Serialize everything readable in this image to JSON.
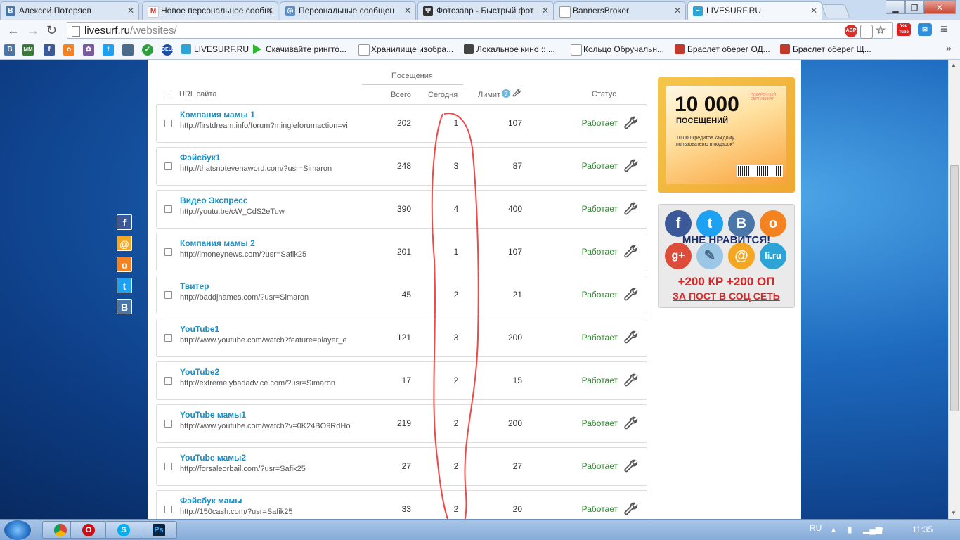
{
  "browser": {
    "tabs": [
      {
        "title": "Алексей Потеряев",
        "icon": "vk-icon",
        "color": "#4a76a8",
        "glyph": "В"
      },
      {
        "title": "Новое персональное сообщ",
        "icon": "gmail-icon",
        "color": "#d93025",
        "glyph": "M"
      },
      {
        "title": "Персональные сообщен",
        "icon": "globe-icon",
        "color": "#5b8fc7",
        "glyph": "◎"
      },
      {
        "title": "Фотозавр - Быстрый фот",
        "icon": "photozavr-icon",
        "color": "#333333",
        "glyph": "Ψ"
      },
      {
        "title": "BannersBroker",
        "icon": "page-icon",
        "color": "#ffffff",
        "glyph": ""
      },
      {
        "title": "LIVESURF.RU",
        "icon": "livesurf-icon",
        "color": "#2ea3d6",
        "glyph": "~"
      }
    ],
    "url_host": "livesurf.ru",
    "url_path": "/websites/",
    "bookmarks": [
      {
        "label": "LIVESURF.RU",
        "color": "#2ea3d6"
      },
      {
        "label": "Скачивайте рингто...",
        "color": "#2eb82e"
      },
      {
        "label": "Хранилище изобра...",
        "color": "#ffffff"
      },
      {
        "label": "Локальное кино :: ...",
        "color": "#444444"
      },
      {
        "label": "Кольцо Обручальн...",
        "color": "#ffffff"
      },
      {
        "label": "Браслет оберег ОД...",
        "color": "#c0392b"
      },
      {
        "label": "Браслет оберег Щ...",
        "color": "#c0392b"
      }
    ],
    "ext_abp": "ABP",
    "ext_yt": "You Tube"
  },
  "table": {
    "header_visits": "Посещения",
    "header_url": "URL сайта",
    "header_total": "Всего",
    "header_today": "Сегодня",
    "header_limit": "Лимит",
    "header_status": "Статус",
    "rows": [
      {
        "name": "Компания мамы 1",
        "url": "http://firstdream.info/forum?mingleforumaction=vi",
        "total": "202",
        "today": "1",
        "limit": "107",
        "status": "Работает"
      },
      {
        "name": "Фэйсбук1",
        "url": "http://thatsnotevenaword.com/?usr=Simaron",
        "total": "248",
        "today": "3",
        "limit": "87",
        "status": "Работает"
      },
      {
        "name": "Видео Экспресс",
        "url": "http://youtu.be/cW_CdS2eTuw",
        "total": "390",
        "today": "4",
        "limit": "400",
        "status": "Работает"
      },
      {
        "name": "Компания мамы 2",
        "url": "http://imoneynews.com/?usr=Safik25",
        "total": "201",
        "today": "1",
        "limit": "107",
        "status": "Работает"
      },
      {
        "name": "Твитер",
        "url": "http://baddjnames.com/?usr=Simaron",
        "total": "45",
        "today": "2",
        "limit": "21",
        "status": "Работает"
      },
      {
        "name": "YouTube1",
        "url": "http://www.youtube.com/watch?feature=player_e",
        "total": "121",
        "today": "3",
        "limit": "200",
        "status": "Работает"
      },
      {
        "name": "YouTube2",
        "url": "http://extremelybadadvice.com/?usr=Simaron",
        "total": "17",
        "today": "2",
        "limit": "15",
        "status": "Работает"
      },
      {
        "name": "YouTube мамы1",
        "url": "http://www.youtube.com/watch?v=0K24BO9RdHo",
        "total": "219",
        "today": "2",
        "limit": "200",
        "status": "Работает"
      },
      {
        "name": "YouTube мамы2",
        "url": "http://forsaleorbail.com/?usr=Safik25",
        "total": "27",
        "today": "2",
        "limit": "27",
        "status": "Работает"
      },
      {
        "name": "Фэйсбук мамы",
        "url": "http://150cash.com/?usr=Safik25",
        "total": "33",
        "today": "2",
        "limit": "20",
        "status": "Работает"
      }
    ]
  },
  "promo1": {
    "amount": "10 000",
    "unit": "ПОСЕЩЕНИЙ",
    "desc": "10 000 кредитов каждому пользователю в подарок*",
    "gift": "ПОДАРОЧНЫЙ СЕРТИФИКАТ"
  },
  "promo2": {
    "like": "МНЕ НРАВИТСЯ!",
    "bonus": "+200 КР +200 ОП",
    "post": "ЗА ПОСТ В СОЦ СЕТЬ",
    "liru": "li.ru"
  },
  "taskbar": {
    "lang": "RU",
    "time": "11:35"
  }
}
